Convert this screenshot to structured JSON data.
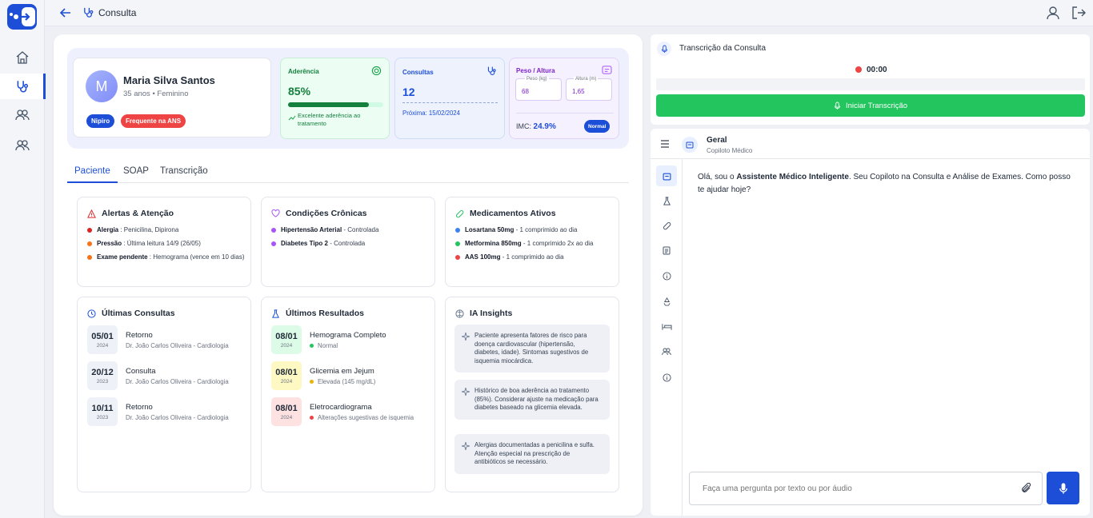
{
  "topbar": {
    "title": "Consulta"
  },
  "patient": {
    "initial": "M",
    "name": "Maria Silva Santos",
    "info": "35 anos • Feminino",
    "tags": [
      "Nipiro",
      "Frequente na ANS"
    ]
  },
  "adherence": {
    "label": "Aderência",
    "value": "85%",
    "percent": 85,
    "note": "Excelente aderência ao tratamento"
  },
  "consultas": {
    "label": "Consultas",
    "value": "12",
    "next": "Próxima: 15/02/2024"
  },
  "weight": {
    "label": "Peso / Altura",
    "peso_label": "Peso (kg)",
    "peso": "68",
    "altura_label": "Altura (m)",
    "altura": "1,65",
    "imc_label": "IMC:",
    "imc": "24.9%",
    "badge": "Normal"
  },
  "tabs": [
    "Paciente",
    "SOAP",
    "Transcrição"
  ],
  "alerts": {
    "title": "Alertas & Atenção",
    "items": [
      {
        "label": "Alergia",
        "text": " : Penicilina, Dipirona",
        "color": "#dc2626"
      },
      {
        "label": "Pressão",
        "text": " : Última leitura 14/9 (26/05)",
        "color": "#f97316"
      },
      {
        "label": "Exame pendente",
        "text": " : Hemograma (vence em 10 dias)",
        "color": "#f97316"
      }
    ]
  },
  "chronic": {
    "title": "Condições Crônicas",
    "items": [
      {
        "label": "Hipertensão Arterial",
        "text": " - Controlada",
        "color": "#a855f7"
      },
      {
        "label": "Diabetes Tipo 2",
        "text": " - Controlada",
        "color": "#a855f7"
      }
    ]
  },
  "meds": {
    "title": "Medicamentos Ativos",
    "items": [
      {
        "label": "Losartana 50mg",
        "text": " - 1 comprimido ao dia",
        "color": "#3b82f6"
      },
      {
        "label": "Metformina 850mg",
        "text": " - 1 comprimido 2x ao dia",
        "color": "#22c55e"
      },
      {
        "label": "AAS 100mg",
        "text": " - 1 comprimido ao dia",
        "color": "#ef4444"
      }
    ]
  },
  "last_consults": {
    "title": "Últimas Consultas",
    "items": [
      {
        "day": "05/01",
        "year": "2024",
        "type": "Retorno",
        "doctor": "Dr. João Carlos Oliveira - Cardiologia"
      },
      {
        "day": "20/12",
        "year": "2023",
        "type": "Consulta",
        "doctor": "Dr. João Carlos Oliveira - Cardiologia"
      },
      {
        "day": "10/11",
        "year": "2023",
        "type": "Retorno",
        "doctor": "Dr. João Carlos Oliveira - Cardiologia"
      }
    ]
  },
  "last_results": {
    "title": "Últimos Resultados",
    "items": [
      {
        "day": "08/01",
        "year": "2024",
        "name": "Hemograma Completo",
        "status": "Normal",
        "color": "#22c55e",
        "bg": "#dcfce7"
      },
      {
        "day": "08/01",
        "year": "2024",
        "name": "Glicemia em Jejum",
        "status": "Elevada (145 mg/dL)",
        "color": "#eab308",
        "bg": "#fef9c3"
      },
      {
        "day": "08/01",
        "year": "2024",
        "name": "Eletrocardiograma",
        "status": "Alterações sugestivas de isquemia",
        "color": "#ef4444",
        "bg": "#fee2e2"
      }
    ]
  },
  "insights": {
    "title": "IA Insights",
    "items": [
      "Paciente apresenta fatores de risco para doença cardiovascular (hipertensão, diabetes, idade). Sintomas sugestivos de isquemia miocárdica.",
      "Histórico de boa aderência ao tratamento (85%). Considerar ajuste na medicação para diabetes baseado na glicemia elevada.",
      "Alergias documentadas a penicilina e sulfa. Atenção especial na prescrição de antibióticos se necessário."
    ]
  },
  "transcription": {
    "title": "Transcrição da Consulta",
    "timer": "00:00",
    "button": "Iniciar Transcrição"
  },
  "chat": {
    "title": "Geral",
    "subtitle": "Copiloto Médico",
    "message_pre": "Olá, sou o ",
    "message_bold": "Assistente Médico Inteligente",
    "message_post": ". Seu Copiloto na Consulta e Análise de Exames.  Como posso te ajudar hoje?",
    "placeholder": "Faça uma pergunta por texto ou por áudio"
  },
  "colors": {
    "accent": "#1d4ed8",
    "green": "#22c55e",
    "red": "#ef4444"
  }
}
